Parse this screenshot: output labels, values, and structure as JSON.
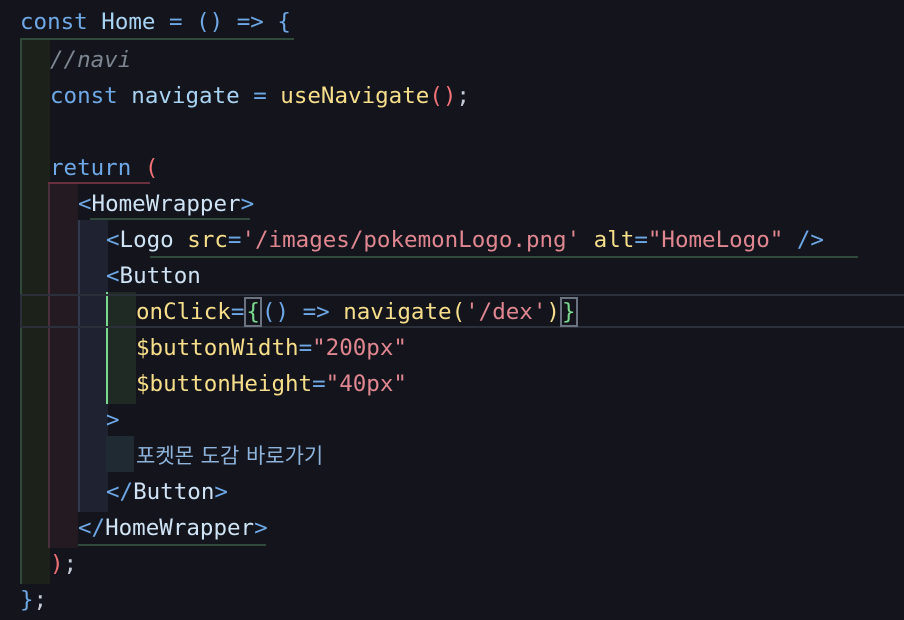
{
  "editor": {
    "lines": [
      {
        "tokens": [
          {
            "t": "const",
            "c": "kw"
          },
          {
            "t": " "
          },
          {
            "t": "Home",
            "c": "ty"
          },
          {
            "t": " "
          },
          {
            "t": "=",
            "c": "op"
          },
          {
            "t": " "
          },
          {
            "t": "()",
            "c": "op"
          },
          {
            "t": " "
          },
          {
            "t": "=>",
            "c": "op"
          },
          {
            "t": " "
          },
          {
            "t": "{",
            "c": "op"
          }
        ]
      },
      {
        "tokens": [
          {
            "t": "//navi",
            "c": "cm"
          }
        ]
      },
      {
        "tokens": [
          {
            "t": "const",
            "c": "kw"
          },
          {
            "t": " "
          },
          {
            "t": "navigate",
            "c": "ty"
          },
          {
            "t": " "
          },
          {
            "t": "=",
            "c": "op"
          },
          {
            "t": " "
          },
          {
            "t": "useNavigate",
            "c": "fn"
          },
          {
            "t": "()",
            "c": "pr"
          },
          {
            "t": ";",
            "c": "pl"
          }
        ]
      },
      {
        "tokens": []
      },
      {
        "tokens": [
          {
            "t": "return",
            "c": "kw"
          },
          {
            "t": " "
          },
          {
            "t": "(",
            "c": "pr"
          }
        ]
      },
      {
        "tokens": [
          {
            "t": "<",
            "c": "tag"
          },
          {
            "t": "HomeWrapper",
            "c": "tn"
          },
          {
            "t": ">",
            "c": "tag"
          }
        ]
      },
      {
        "tokens": [
          {
            "t": "<",
            "c": "tag"
          },
          {
            "t": "Logo",
            "c": "tn"
          },
          {
            "t": " "
          },
          {
            "t": "src",
            "c": "at"
          },
          {
            "t": "=",
            "c": "op"
          },
          {
            "t": "'/images/pokemonLogo.png'",
            "c": "str"
          },
          {
            "t": " "
          },
          {
            "t": "alt",
            "c": "at"
          },
          {
            "t": "=",
            "c": "op"
          },
          {
            "t": "\"HomeLogo\"",
            "c": "str"
          },
          {
            "t": " "
          },
          {
            "t": "/>",
            "c": "tag"
          }
        ]
      },
      {
        "tokens": [
          {
            "t": "<",
            "c": "tag"
          },
          {
            "t": "Button",
            "c": "tn"
          }
        ]
      },
      {
        "tokens": [
          {
            "t": "onClick",
            "c": "at"
          },
          {
            "t": "=",
            "c": "op"
          },
          {
            "t": "{",
            "c": "brk"
          },
          {
            "t": "()",
            "c": "op"
          },
          {
            "t": " "
          },
          {
            "t": "=>",
            "c": "op"
          },
          {
            "t": " "
          },
          {
            "t": "navigate",
            "c": "fn"
          },
          {
            "t": "(",
            "c": "fn"
          },
          {
            "t": "'/dex'",
            "c": "str"
          },
          {
            "t": ")",
            "c": "fn"
          },
          {
            "t": "}",
            "c": "brk"
          }
        ]
      },
      {
        "tokens": [
          {
            "t": "$buttonWidth",
            "c": "at"
          },
          {
            "t": "=",
            "c": "op"
          },
          {
            "t": "\"200px\"",
            "c": "str"
          }
        ]
      },
      {
        "tokens": [
          {
            "t": "$buttonHeight",
            "c": "at"
          },
          {
            "t": "=",
            "c": "op"
          },
          {
            "t": "\"40px\"",
            "c": "str"
          }
        ]
      },
      {
        "tokens": [
          {
            "t": ">",
            "c": "tag"
          }
        ]
      },
      {
        "tokens": [
          {
            "t": "포켓몬 도감 바로가기",
            "c": "kr"
          }
        ]
      },
      {
        "tokens": [
          {
            "t": "</",
            "c": "tag"
          },
          {
            "t": "Button",
            "c": "tn"
          },
          {
            "t": ">",
            "c": "tag"
          }
        ]
      },
      {
        "tokens": [
          {
            "t": "</",
            "c": "tag"
          },
          {
            "t": "HomeWrapper",
            "c": "tn"
          },
          {
            "t": ">",
            "c": "tag"
          }
        ]
      },
      {
        "tokens": [
          {
            "t": ")",
            "c": "pr"
          },
          {
            "t": ";",
            "c": "pl"
          }
        ]
      },
      {
        "tokens": [
          {
            "t": "}",
            "c": "op"
          },
          {
            "t": ";",
            "c": "pl"
          }
        ]
      }
    ]
  }
}
